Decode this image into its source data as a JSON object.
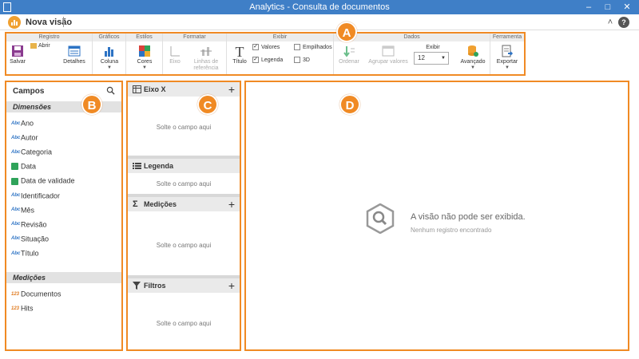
{
  "window": {
    "title": "Analytics - Consulta de documentos"
  },
  "view": {
    "name": "Nova visão"
  },
  "ribbon": {
    "registro": {
      "title": "Registro",
      "salvar": "Salvar",
      "abrir": "Abrir",
      "detalhes": "Detalhes"
    },
    "graficos": {
      "title": "Gráficos",
      "coluna": "Coluna"
    },
    "estilos": {
      "title": "Estilos",
      "cores": "Cores"
    },
    "formatar": {
      "title": "Formatar",
      "eixo": "Eixo",
      "linhas1": "Linhas de",
      "linhas2": "referência"
    },
    "exibir": {
      "title": "Exibir",
      "titulo": "Título",
      "valores": "Valores",
      "legenda": "Legenda",
      "empilhados": "Empilhados",
      "tres_d": "3D"
    },
    "dados": {
      "title": "Dados",
      "ordenar": "Ordenar",
      "agrupar": "Agrupar valores",
      "exibir_label": "Exibir",
      "exibir_value": "12",
      "avancado": "Avançado"
    },
    "ferramenta": {
      "title": "Ferramenta",
      "exportar": "Exportar"
    }
  },
  "badges": {
    "a": "A",
    "b": "B",
    "c": "C",
    "d": "D"
  },
  "campos": {
    "title": "Campos",
    "dimensoes_title": "Dimensões",
    "dimensoes": [
      {
        "icon": "Abc",
        "label": "Ano"
      },
      {
        "icon": "Abc",
        "label": "Autor"
      },
      {
        "icon": "Abc",
        "label": "Categoria"
      },
      {
        "icon": "calendar",
        "label": "Data"
      },
      {
        "icon": "calendar",
        "label": "Data de validade"
      },
      {
        "icon": "Abc",
        "label": "Identificador"
      },
      {
        "icon": "Abc",
        "label": "Mês"
      },
      {
        "icon": "Abc",
        "label": "Revisão"
      },
      {
        "icon": "Abc",
        "label": "Situação"
      },
      {
        "icon": "Abc",
        "label": "Título"
      }
    ],
    "medicoes_title": "Medições",
    "medicoes": [
      {
        "icon": "123",
        "label": "Documentos"
      },
      {
        "icon": "123",
        "label": "Hits"
      }
    ]
  },
  "drops": {
    "eixo_x": {
      "title": "Eixo X",
      "hint": "Solte o campo aqui"
    },
    "legenda": {
      "title": "Legenda",
      "hint": "Solte o campo aqui"
    },
    "medicoes": {
      "title": "Medições",
      "hint": "Solte o campo aqui"
    },
    "filtros": {
      "title": "Filtros",
      "hint": "Solte o campo aqui"
    }
  },
  "empty": {
    "title": "A visão não pode ser exibida.",
    "subtitle": "Nenhum registro encontrado"
  },
  "colors": {
    "accent": "#f08a24",
    "titlebar": "#3f7fc7"
  }
}
